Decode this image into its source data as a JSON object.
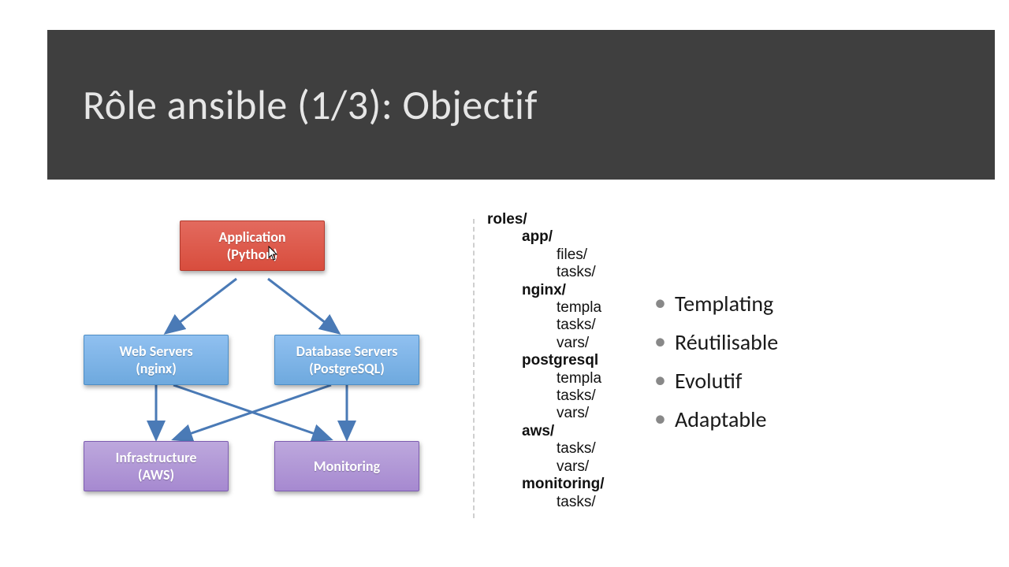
{
  "title": "Rôle ansible (1/3): Objectif",
  "colors": {
    "titlebar_bg": "#3f3f3f",
    "node_red": "#d84d3d",
    "node_blue": "#6ea9de",
    "node_purple": "#a689d0",
    "arrow": "#4a7ab6"
  },
  "diagram": {
    "nodes": {
      "app": {
        "line1": "Application",
        "line2": "(Python)"
      },
      "web": {
        "line1": "Web Servers",
        "line2": "(nginx)"
      },
      "db": {
        "line1": "Database Servers",
        "line2": "(PostgreSQL)"
      },
      "infra": {
        "line1": "Infrastructure",
        "line2": "(AWS)"
      },
      "mon": {
        "line1": "Monitoring",
        "line2": ""
      }
    },
    "edges": [
      [
        "app",
        "web"
      ],
      [
        "app",
        "db"
      ],
      [
        "web",
        "infra"
      ],
      [
        "web",
        "mon"
      ],
      [
        "db",
        "infra"
      ],
      [
        "db",
        "mon"
      ]
    ]
  },
  "tree": [
    {
      "depth": 0,
      "text": "roles/"
    },
    {
      "depth": 1,
      "text": "app/"
    },
    {
      "depth": 2,
      "text": "files/"
    },
    {
      "depth": 2,
      "text": "tasks/"
    },
    {
      "depth": 1,
      "text": "nginx/"
    },
    {
      "depth": 2,
      "text": "templa"
    },
    {
      "depth": 2,
      "text": "tasks/"
    },
    {
      "depth": 2,
      "text": "vars/"
    },
    {
      "depth": 1,
      "text": "postgresql"
    },
    {
      "depth": 2,
      "text": "templa"
    },
    {
      "depth": 2,
      "text": "tasks/"
    },
    {
      "depth": 2,
      "text": "vars/"
    },
    {
      "depth": 1,
      "text": "aws/"
    },
    {
      "depth": 2,
      "text": "tasks/"
    },
    {
      "depth": 2,
      "text": "vars/"
    },
    {
      "depth": 1,
      "text": "monitoring/"
    },
    {
      "depth": 2,
      "text": "tasks/"
    }
  ],
  "bullets": [
    "Templating",
    "Réutilisable",
    "Evolutif",
    "Adaptable"
  ]
}
